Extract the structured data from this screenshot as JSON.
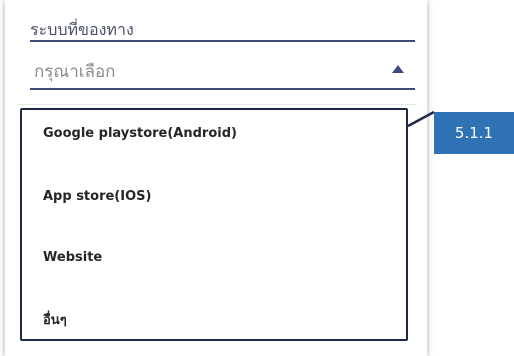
{
  "field": {
    "label": "ระบบที่ของทาง",
    "placeholder": "กรุณาเลือก"
  },
  "menu": {
    "items": [
      "Google playstore(Android)",
      "App store(IOS)",
      "Website",
      "อื่นๆ"
    ]
  },
  "callout": {
    "label": "5.1.1"
  },
  "colors": {
    "accent": "#3d4a7a",
    "callout": "#2f72b5",
    "highlight_border": "#1e2a45"
  }
}
